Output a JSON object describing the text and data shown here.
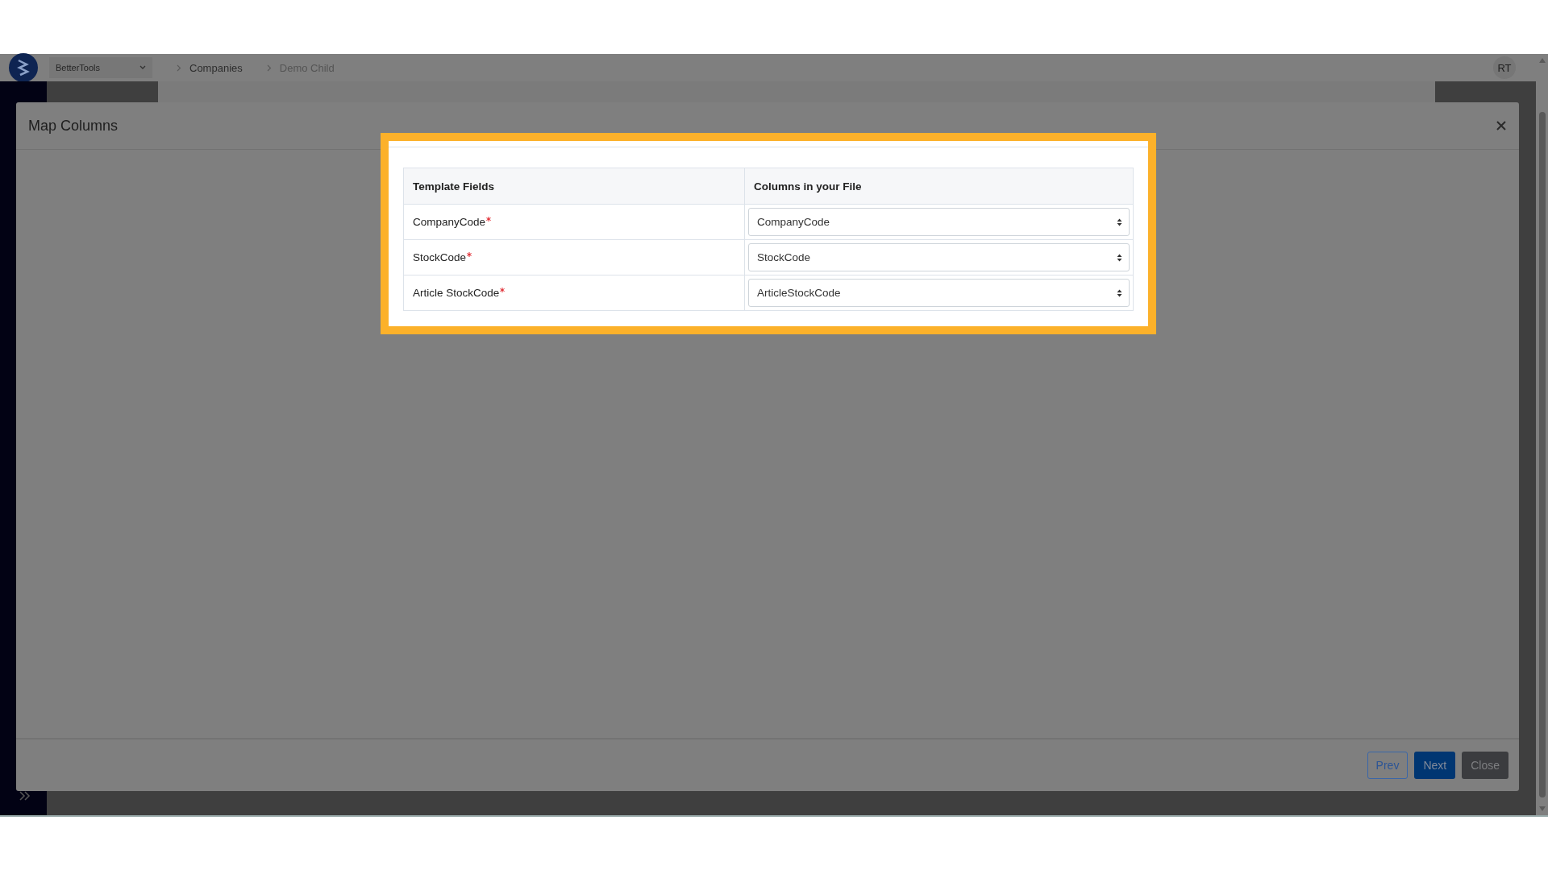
{
  "top_bar": {
    "company_select": "BetterTools",
    "breadcrumb": [
      "Companies",
      "Demo Child"
    ],
    "avatar": "RT"
  },
  "modal": {
    "title": "Map Columns",
    "table": {
      "columns": [
        "Template Fields",
        "Columns in your File"
      ],
      "rows": [
        {
          "field": "CompanyCode",
          "required": true,
          "mapped": "CompanyCode"
        },
        {
          "field": "StockCode",
          "required": true,
          "mapped": "StockCode"
        },
        {
          "field": "Article StockCode",
          "required": true,
          "mapped": "ArticleStockCode"
        }
      ]
    },
    "buttons": [
      {
        "label": "Prev",
        "kind": "outline"
      },
      {
        "label": "Next",
        "kind": "primary"
      },
      {
        "label": "Close",
        "kind": "secondary"
      }
    ]
  }
}
